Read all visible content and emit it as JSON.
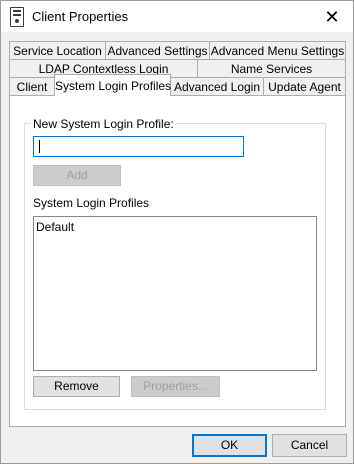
{
  "window": {
    "title": "Client Properties",
    "close_glyph": "✕"
  },
  "tabs": {
    "row1": [
      {
        "label": "Service Location"
      },
      {
        "label": "Advanced Settings"
      },
      {
        "label": "Advanced Menu Settings"
      }
    ],
    "row2": [
      {
        "label": "LDAP Contextless Login"
      },
      {
        "label": "Name Services"
      }
    ],
    "row3": [
      {
        "label": "Client"
      },
      {
        "label": "System Login Profiles",
        "active": true
      },
      {
        "label": "Advanced Login"
      },
      {
        "label": "Update Agent"
      }
    ]
  },
  "panel": {
    "group_label": "New System Login Profile:",
    "new_profile_value": "",
    "add_label": "Add",
    "list_label": "System Login Profiles",
    "profiles": [
      "Default"
    ],
    "remove_label": "Remove",
    "properties_label": "Properties..."
  },
  "footer": {
    "ok_label": "OK",
    "cancel_label": "Cancel"
  },
  "colors": {
    "accent": "#0078d7",
    "disabled_text": "#a0a0a0"
  }
}
